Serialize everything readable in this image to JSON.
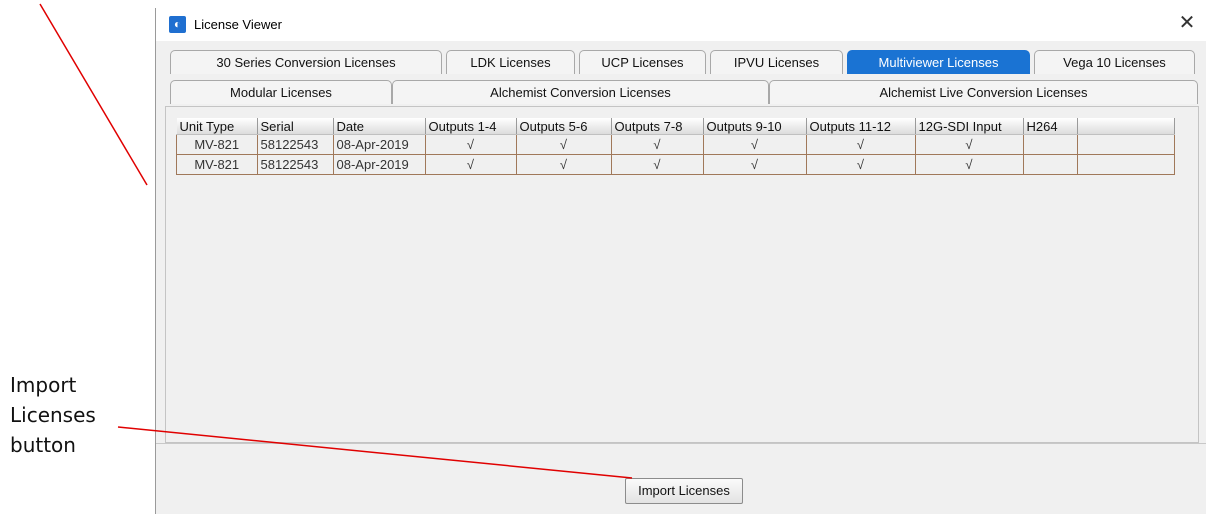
{
  "annotation": {
    "line1": "Import",
    "line2": "Licenses",
    "line3": "button"
  },
  "window": {
    "title": "License Viewer",
    "close_glyph": "✕"
  },
  "tabs_row1": [
    {
      "label": "30 Series Conversion Licenses",
      "active": false
    },
    {
      "label": "LDK Licenses",
      "active": false
    },
    {
      "label": "UCP Licenses",
      "active": false
    },
    {
      "label": "IPVU Licenses",
      "active": false
    },
    {
      "label": "Multiviewer Licenses",
      "active": true
    },
    {
      "label": "Vega 10 Licenses",
      "active": false
    }
  ],
  "tabs_row2": [
    {
      "label": "Modular Licenses"
    },
    {
      "label": "Alchemist Conversion Licenses"
    },
    {
      "label": "Alchemist Live Conversion Licenses"
    }
  ],
  "table": {
    "columns": [
      "Unit Type",
      "Serial",
      "Date",
      "Outputs 1-4",
      "Outputs 5-6",
      "Outputs 7-8",
      "Outputs 9-10",
      "Outputs 11-12",
      "12G-SDI Input",
      "H264",
      ""
    ],
    "rows": [
      [
        "MV-821",
        "58122543",
        "08-Apr-2019",
        "√",
        "√",
        "√",
        "√",
        "√",
        "√",
        "",
        ""
      ],
      [
        "MV-821",
        "58122543",
        "08-Apr-2019",
        "√",
        "√",
        "√",
        "√",
        "√",
        "√",
        "",
        ""
      ]
    ]
  },
  "buttons": {
    "import": "Import Licenses"
  },
  "colors": {
    "active_tab": "#1a73d3",
    "annotation_line": "#e00000",
    "row_border": "#a0785a"
  },
  "icons": {
    "app": "app-logo-icon",
    "close": "close-icon"
  }
}
